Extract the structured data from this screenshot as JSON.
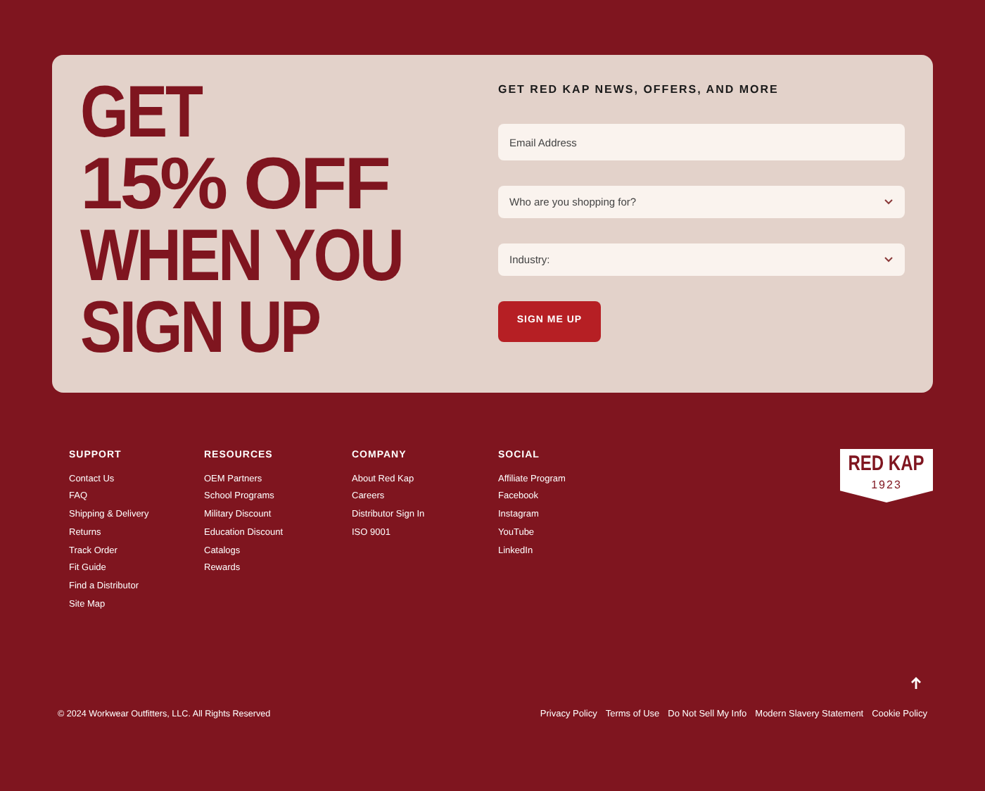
{
  "signup": {
    "headline": [
      "GET",
      "15% OFF",
      "WHEN YOU",
      "SIGN UP"
    ],
    "form_title": "GET RED KAP NEWS, OFFERS, AND MORE",
    "email": {
      "placeholder": "Email Address"
    },
    "selects": [
      {
        "placeholder": "Who are you shopping for?"
      },
      {
        "placeholder": "Industry:"
      }
    ],
    "button": "SIGN ME UP"
  },
  "footer": {
    "columns": [
      {
        "title": "SUPPORT",
        "links": [
          "Contact Us",
          "FAQ",
          "Shipping & Delivery",
          "Returns",
          "Track Order",
          "Fit Guide",
          "Find a Distributor",
          "Site Map"
        ]
      },
      {
        "title": "RESOURCES",
        "links": [
          "OEM Partners",
          "School Programs",
          "Military Discount",
          "Education Discount",
          "Catalogs",
          "Rewards"
        ]
      },
      {
        "title": "COMPANY",
        "links": [
          "About Red Kap",
          "Careers",
          "Distributor Sign In",
          "ISO 9001"
        ]
      },
      {
        "title": "SOCIAL",
        "links": [
          "Affiliate Program",
          "Facebook",
          "Instagram",
          "YouTube",
          "LinkedIn"
        ]
      }
    ],
    "logo": {
      "name": "RED KAP",
      "year": "1923"
    },
    "copyright": "© 2024 Workwear Outfitters, LLC. All Rights Reserved",
    "legal_links": [
      "Privacy Policy",
      "Terms of Use",
      "Do Not Sell My Info",
      "Modern Slavery Statement",
      "Cookie Policy"
    ]
  }
}
